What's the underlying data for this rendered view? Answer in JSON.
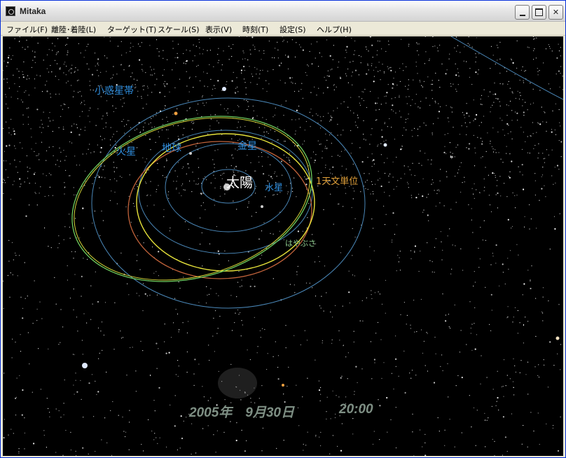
{
  "window": {
    "title": "Mitaka",
    "icon": "mitaka-app-icon"
  },
  "menu": [
    "ファイル(F)",
    "離陸･着陸(L)",
    "ターゲット(T)",
    "スケール(S)",
    "表示(V)",
    "時刻(T)",
    "設定(S)",
    "ヘルプ(H)"
  ],
  "labels": {
    "asteroid_belt": "小惑星帯",
    "mars": "火星",
    "earth": "地球",
    "venus": "金星",
    "sun": "太陽",
    "mercury": "水星",
    "au_marker": "1天文単位",
    "hayabusa": "はやぶさ"
  },
  "datetime": {
    "date": "2005年　9月30日",
    "time": "20:00"
  },
  "colors": {
    "planet_label": "#2f8fe0",
    "orbit": "#4a87b8",
    "hayabusa_orbit_yellow": "#e6e23a",
    "hayabusa_orbit_red": "#c0623a",
    "mars_orbit_green": "#6fcf5f",
    "au_marker": "#e3a23a",
    "datetime": "#7e8f84"
  }
}
